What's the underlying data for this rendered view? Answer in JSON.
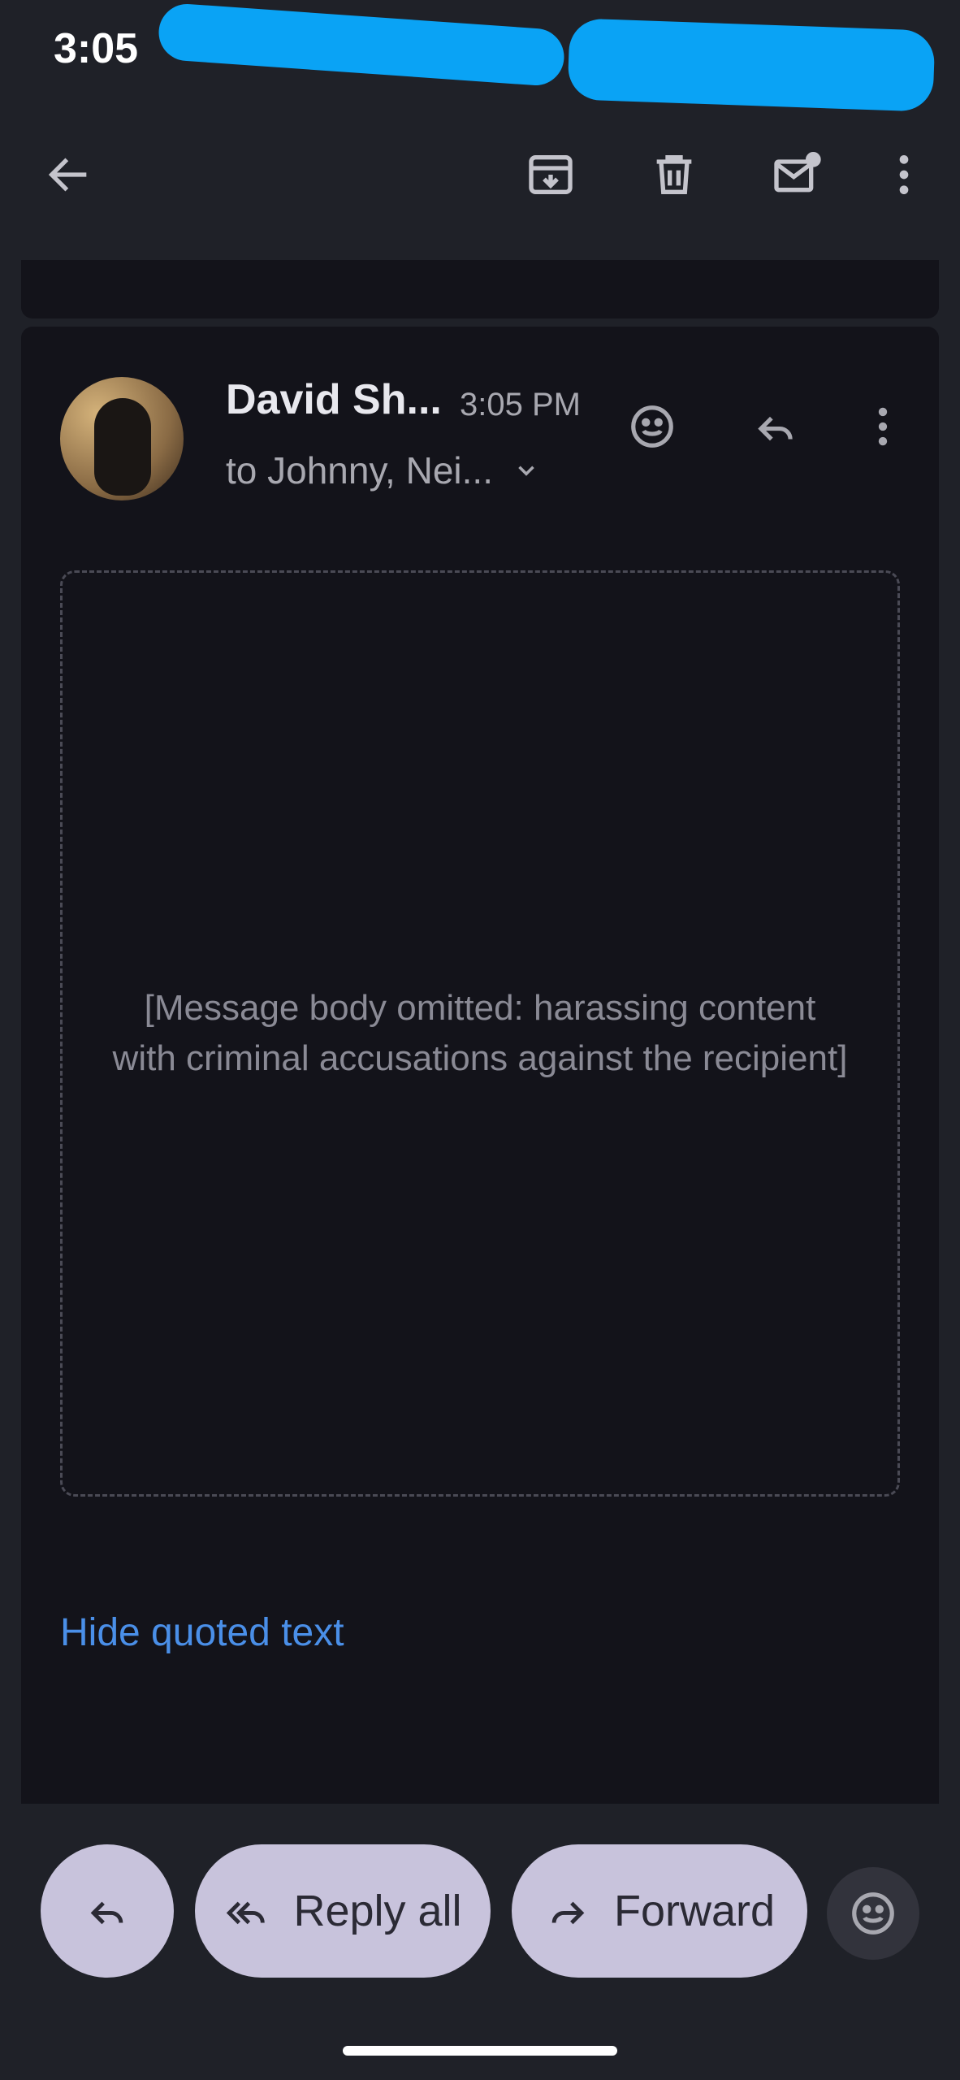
{
  "status_bar": {
    "time": "3:05"
  },
  "toolbar": {
    "icons": [
      "back-arrow-icon",
      "archive-icon",
      "trash-icon",
      "mark-unread-icon",
      "more-vert-icon"
    ]
  },
  "message": {
    "sender": "David Sh...",
    "time": "3:05 PM",
    "recipients": "to Johnny, Nei...",
    "hide_quoted_label": "Hide quoted text"
  },
  "actions": {
    "reply_all_label": "Reply all",
    "forward_label": "Forward"
  },
  "colors": {
    "background": "#1f2128",
    "card": "#13131a",
    "accent_link": "#4a8fe8",
    "pill": "#c8c3dc",
    "redaction": "#0aa3f5"
  }
}
